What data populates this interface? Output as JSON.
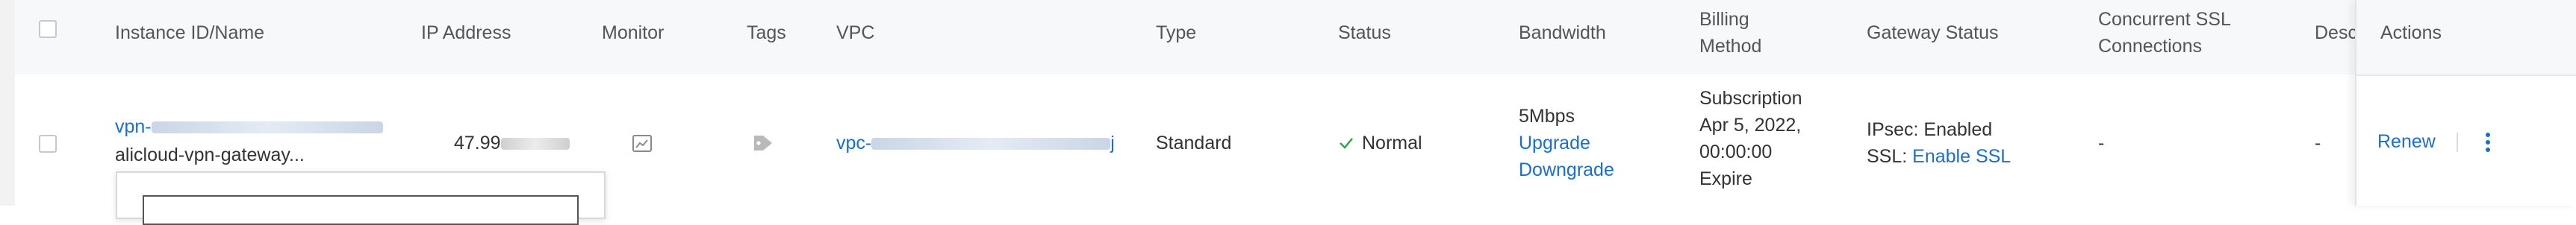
{
  "headers": {
    "instance": "Instance ID/Name",
    "ip": "IP Address",
    "monitor": "Monitor",
    "tags": "Tags",
    "vpc": "VPC",
    "type": "Type",
    "status": "Status",
    "bandwidth": "Bandwidth",
    "billing_line1": "Billing",
    "billing_line2": "Method",
    "gateway": "Gateway Status",
    "ssl_line1": "Concurrent SSL",
    "ssl_line2": "Connections",
    "desc": "Desc",
    "actions": "Actions"
  },
  "row": {
    "instance_id_prefix": "vpn-",
    "instance_name": "alicloud-vpn-gateway...",
    "ip_prefix": "47.99",
    "vpc_prefix": "vpc-",
    "vpc_suffix": "j",
    "type": "Standard",
    "status": "Normal",
    "status_color": "#2ea44f",
    "bandwidth": "5Mbps",
    "upgrade": "Upgrade",
    "downgrade": "Downgrade",
    "billing_type": "Subscription",
    "billing_date": "Apr 5, 2022,",
    "billing_time": "00:00:00",
    "billing_expire": "Expire",
    "ipsec": "IPsec: Enabled",
    "ssl_label": "SSL: ",
    "ssl_link": "Enable SSL",
    "concurrent_ssl": "-",
    "desc": "-",
    "renew": "Renew"
  },
  "icons": {
    "monitor": "monitor-chart-icon",
    "tag": "tag-icon",
    "status": "checkmark-icon",
    "more": "more-vertical-icon"
  },
  "colors": {
    "link": "#1a6fc9",
    "header_bg": "#f7f8fa"
  }
}
